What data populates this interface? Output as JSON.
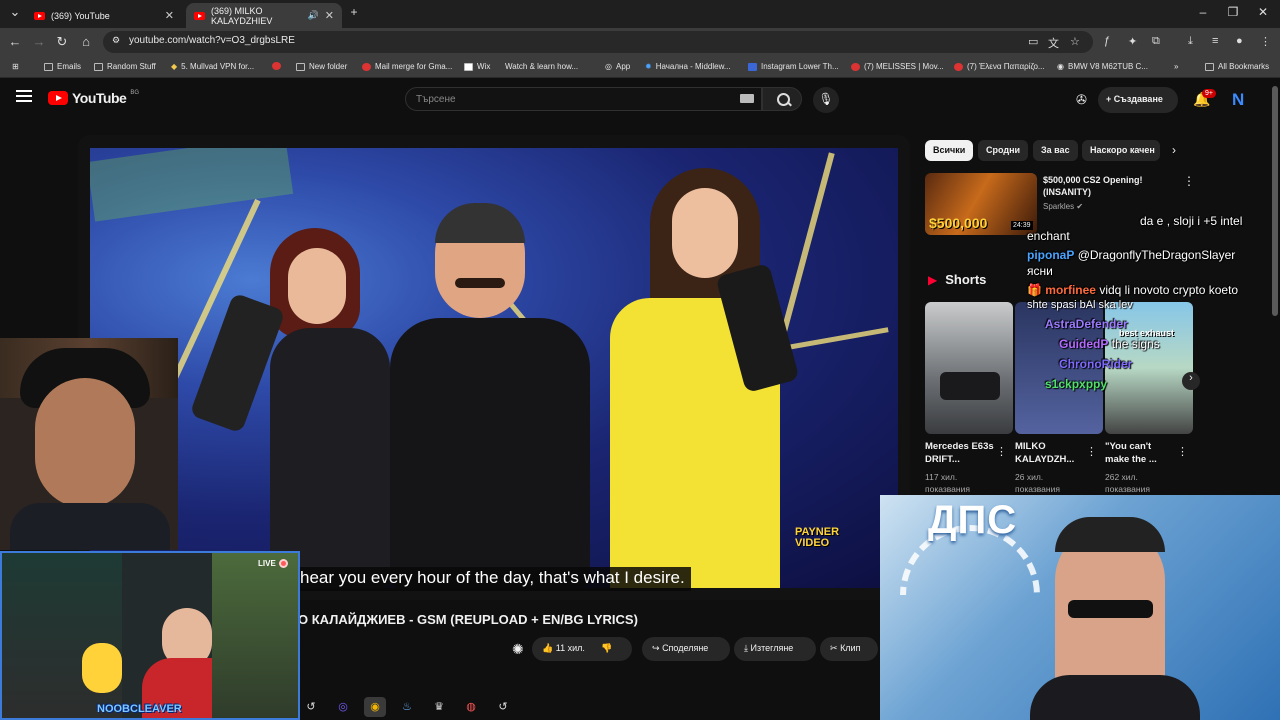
{
  "browser": {
    "tabs": [
      {
        "title": "(369) YouTube",
        "active": false
      },
      {
        "title": "(369) MILKO KALAYDZHIEV",
        "active": true
      }
    ],
    "url": "youtube.com/watch?v=O3_drgbsLRE",
    "bookmarks": [
      "Emails",
      "Random Stuff",
      "5. Mullvad VPN for...",
      "New folder",
      "Mail merge for Gma...",
      "Wix",
      "Watch & learn how...",
      "App",
      "Начална - Middlew...",
      "Instagram Lower Th...",
      "(7) MELISSES | Mov...",
      "(7) Έλενα Παπαρίζο...",
      "BMW V8 M62TUB C..."
    ],
    "all_bookmarks": "All Bookmarks"
  },
  "youtube": {
    "logo_text": "YouTube",
    "logo_country": "BG",
    "search_placeholder": "Търсене",
    "create_label": "Създаване",
    "notifications": "9+",
    "avatar_letter": "N"
  },
  "video": {
    "subtitle": "hear you every hour of the day, that's what I desire.",
    "watermark_top": "PAYNER",
    "watermark_bottom": "VIDEO",
    "title": "О КАЛАЙДЖИЕВ - GSM (REUPLOAD + EN/BG LYRICS)",
    "likes": "11 хил.",
    "share": "Споделяне",
    "download": "Изтегляне",
    "clip": "Клип"
  },
  "filters": [
    "Всички",
    "Сродни",
    "За вас",
    "Наскоро качен"
  ],
  "recommendation": {
    "title": "$500,000 CS2 Opening! (INSANITY)",
    "channel": "Sparkles",
    "thumb_text": "$500,000",
    "duration": "24:39"
  },
  "shorts": {
    "header": "Shorts",
    "items": [
      {
        "title": "Mercedes E63s DRIFT...",
        "views1": "117 хил.",
        "views2": "показвания"
      },
      {
        "title": "MILKO KALAYDZH...",
        "views1": "26 хил.",
        "views2": "показвания"
      },
      {
        "title": "\"You can't make the ...",
        "views1": "262 хил.",
        "views2": "показвания"
      }
    ],
    "overlay": "best exhaust"
  },
  "chat": [
    {
      "name": "",
      "msg": "da e , sloji i +5 intel"
    },
    {
      "name": "",
      "msg": "enchant"
    },
    {
      "name": "piponaP",
      "msg": "@DragonflyTheDragonSlayer"
    },
    {
      "name": "",
      "msg": "ясни"
    },
    {
      "name": "morfinee",
      "msg": "vidq li novoto crypto koeto"
    },
    {
      "name": "",
      "msg": "shte spasi bAl   ska lev"
    },
    {
      "name": "AstraDefender",
      "msg": ""
    },
    {
      "name": "GuidedP",
      "msg": "the signs"
    },
    {
      "name": "ChronoRider",
      "msg": ""
    },
    {
      "name": "s1ckpxppy",
      "msg": ""
    }
  ],
  "stream": {
    "live": "LIVE",
    "cam_label": "NOOBCLEAVER",
    "meme_text": "ДПС"
  }
}
